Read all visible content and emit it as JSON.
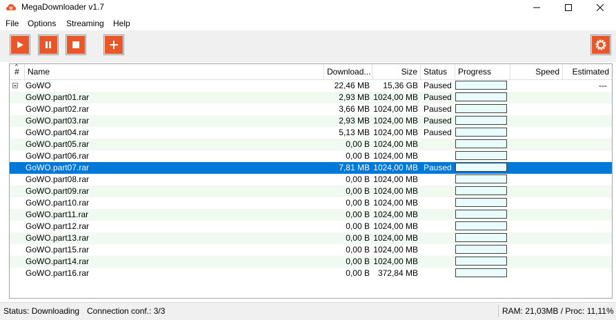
{
  "window": {
    "title": "MegaDownloader v1.7"
  },
  "menu": {
    "items": [
      "File",
      "Options",
      "Streaming",
      "Help"
    ]
  },
  "columns": {
    "num": "#",
    "name": "Name",
    "downloaded": "Download...",
    "size": "Size",
    "status": "Status",
    "progress": "Progress",
    "speed": "Speed",
    "estimated": "Estimated"
  },
  "rows": [
    {
      "name": "GoWO",
      "downloaded": "22,46 MB",
      "size": "15,36 GB",
      "status": "Paused",
      "estimated": "---",
      "group": true
    },
    {
      "name": "GoWO.part01.rar",
      "downloaded": "2,93 MB",
      "size": "1024,00 MB",
      "status": "Paused",
      "estimated": ""
    },
    {
      "name": "GoWO.part02.rar",
      "downloaded": "3,66 MB",
      "size": "1024,00 MB",
      "status": "Paused",
      "estimated": ""
    },
    {
      "name": "GoWO.part03.rar",
      "downloaded": "2,93 MB",
      "size": "1024,00 MB",
      "status": "Paused",
      "estimated": ""
    },
    {
      "name": "GoWO.part04.rar",
      "downloaded": "5,13 MB",
      "size": "1024,00 MB",
      "status": "Paused",
      "estimated": ""
    },
    {
      "name": "GoWO.part05.rar",
      "downloaded": "0,00 B",
      "size": "1024,00 MB",
      "status": "",
      "estimated": ""
    },
    {
      "name": "GoWO.part06.rar",
      "downloaded": "0,00 B",
      "size": "1024,00 MB",
      "status": "",
      "estimated": ""
    },
    {
      "name": "GoWO.part07.rar",
      "downloaded": "7,81 MB",
      "size": "1024,00 MB",
      "status": "Paused",
      "estimated": "",
      "selected": true
    },
    {
      "name": "GoWO.part08.rar",
      "downloaded": "0,00 B",
      "size": "1024,00 MB",
      "status": "",
      "estimated": ""
    },
    {
      "name": "GoWO.part09.rar",
      "downloaded": "0,00 B",
      "size": "1024,00 MB",
      "status": "",
      "estimated": ""
    },
    {
      "name": "GoWO.part10.rar",
      "downloaded": "0,00 B",
      "size": "1024,00 MB",
      "status": "",
      "estimated": ""
    },
    {
      "name": "GoWO.part11.rar",
      "downloaded": "0,00 B",
      "size": "1024,00 MB",
      "status": "",
      "estimated": ""
    },
    {
      "name": "GoWO.part12.rar",
      "downloaded": "0,00 B",
      "size": "1024,00 MB",
      "status": "",
      "estimated": ""
    },
    {
      "name": "GoWO.part13.rar",
      "downloaded": "0,00 B",
      "size": "1024,00 MB",
      "status": "",
      "estimated": ""
    },
    {
      "name": "GoWO.part15.rar",
      "downloaded": "0,00 B",
      "size": "1024,00 MB",
      "status": "",
      "estimated": ""
    },
    {
      "name": "GoWO.part14.rar",
      "downloaded": "0,00 B",
      "size": "1024,00 MB",
      "status": "",
      "estimated": ""
    },
    {
      "name": "GoWO.part16.rar",
      "downloaded": "0,00 B",
      "size": "372,84 MB",
      "status": "",
      "estimated": ""
    }
  ],
  "statusbar": {
    "status": "Status: Downloading",
    "connection": "Connection conf.: 3/3",
    "resources": "RAM: 21,03MB / Proc: 11,11%"
  },
  "colors": {
    "accent": "#e8572a",
    "selection": "#0078d7",
    "alt_row": "#f0faf0"
  },
  "icons": [
    "app-logo-icon",
    "play-icon",
    "pause-icon",
    "stop-icon",
    "add-icon",
    "settings-gear-icon"
  ]
}
